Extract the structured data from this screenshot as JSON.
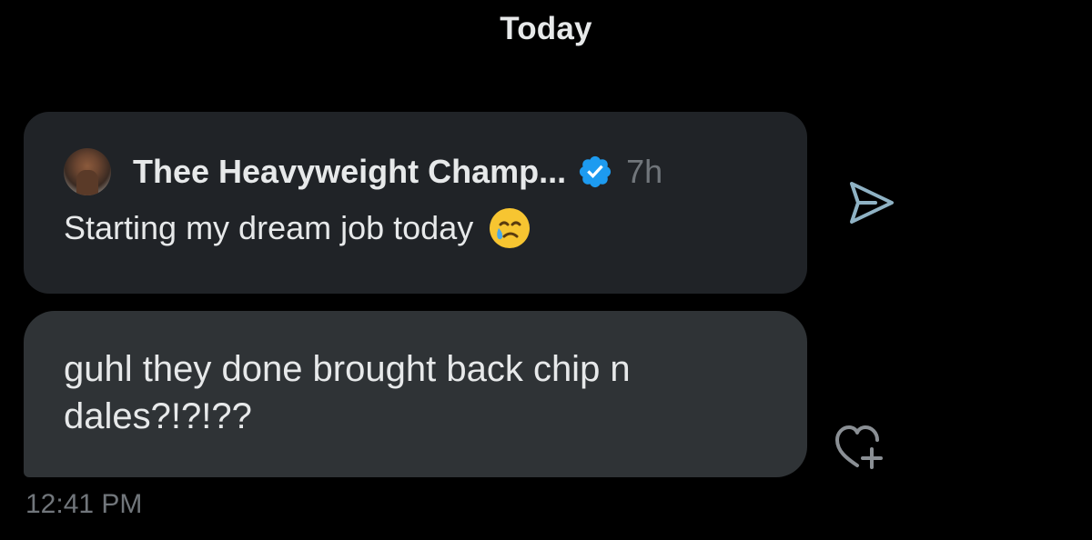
{
  "header": {
    "date_label": "Today"
  },
  "quoted_post": {
    "author_name": "Thee Heavyweight Champ...",
    "verified": true,
    "time_ago": "7h",
    "text": "Starting my dream job today",
    "emoji": "face-holding-back-tears"
  },
  "message": {
    "text": "guhl they done brought back chip n dales?!?!??",
    "timestamp": "12:41 PM"
  },
  "icons": {
    "share": "send-icon",
    "react": "heart-add-icon"
  },
  "colors": {
    "background": "#000000",
    "card": "#202327",
    "bubble": "#2f3336",
    "text": "#e7e9ea",
    "muted": "#71767b",
    "verified_blue": "#1d9bf0"
  }
}
